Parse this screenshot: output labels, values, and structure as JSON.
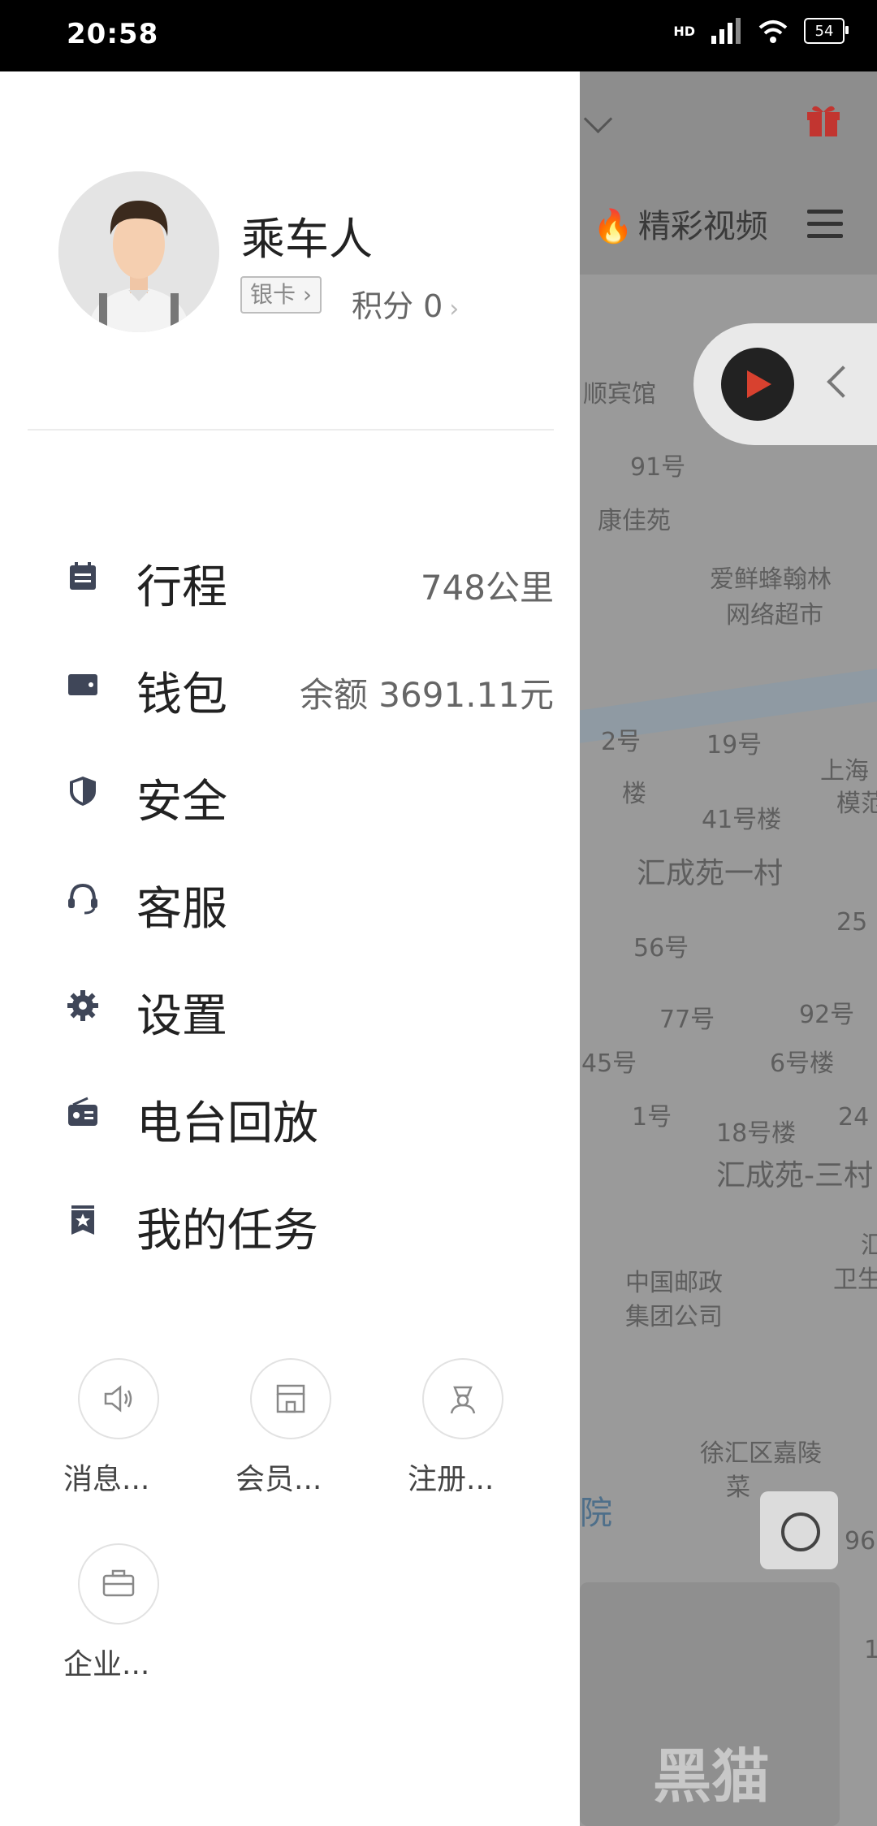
{
  "status_bar": {
    "time": "20:58",
    "hd": "HD",
    "battery": "54"
  },
  "map": {
    "hot_label": "精彩视频",
    "labels": [
      "顺宾馆",
      "91号",
      "康佳苑",
      "爱鲜蜂翰林",
      "网络超市",
      "2号",
      "19号",
      "上海",
      "模范",
      "楼",
      "41号楼",
      "汇成苑一村",
      "56号",
      "25",
      "77号",
      "92号",
      "45号",
      "6号楼",
      "1号",
      "18号楼",
      "24",
      "汇成苑-三村",
      "中国邮政",
      "集团公司",
      "汇",
      "卫生",
      "徐汇区嘉陵",
      "菜",
      "院",
      "96",
      "1"
    ],
    "watermark": "黑猫"
  },
  "profile": {
    "name": "乘车人",
    "tier": "银卡",
    "points_label": "积分 0"
  },
  "menu": [
    {
      "label": "行程",
      "value": "748公里",
      "icon": "calendar-icon"
    },
    {
      "label": "钱包",
      "value": "余额 3691.11元",
      "icon": "wallet-icon"
    },
    {
      "label": "安全",
      "value": "",
      "icon": "shield-icon"
    },
    {
      "label": "客服",
      "value": "",
      "icon": "headset-icon"
    },
    {
      "label": "设置",
      "value": "",
      "icon": "gear-icon"
    },
    {
      "label": "电台回放",
      "value": "",
      "icon": "radio-icon"
    },
    {
      "label": "我的任务",
      "value": "",
      "icon": "badge-icon"
    }
  ],
  "quick_actions": [
    {
      "label": "消息...",
      "icon": "speaker-icon"
    },
    {
      "label": "会员...",
      "icon": "store-icon"
    },
    {
      "label": "注册...",
      "icon": "driver-icon"
    },
    {
      "label": "企业...",
      "icon": "briefcase-icon"
    }
  ],
  "colors": {
    "icon": "#3f4658",
    "map_bg": "#9a9a9a",
    "gift": "#d0322e"
  }
}
